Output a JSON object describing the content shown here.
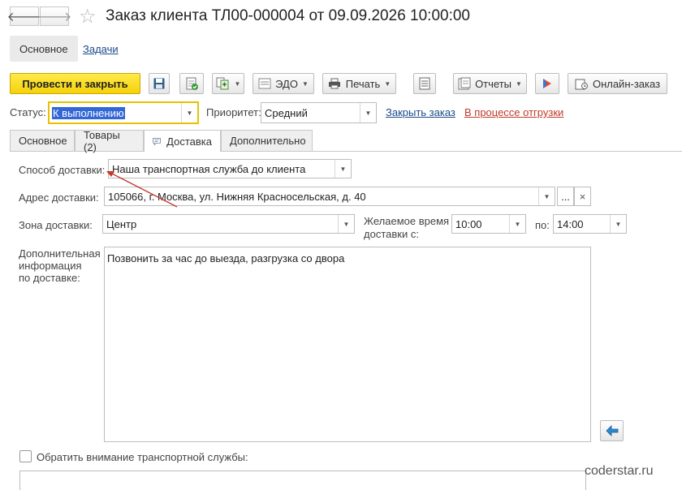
{
  "window": {
    "title": "Заказ клиента ТЛ00-000004 от 09.09.2026 10:00:00",
    "back_glyph": "🡐",
    "forward_glyph": "🡒",
    "star_glyph": "☆"
  },
  "sections": {
    "main": "Основное",
    "tasks": "Задачи"
  },
  "toolbar": {
    "post_close": "Провести и закрыть",
    "edo": "ЭДО",
    "print": "Печать",
    "reports": "Отчеты",
    "online_order": "Онлайн-заказ"
  },
  "status_row": {
    "status_label": "Статус:",
    "status_value": "К выполнению",
    "priority_label": "Приоритет:",
    "priority_value": "Средний",
    "close_order_link": "Закрыть заказ",
    "shipping_link": "В процессе отгрузки"
  },
  "tabs": [
    "Основное",
    "Товары (2)",
    "Доставка",
    "Дополнительно"
  ],
  "delivery": {
    "method_label": "Способ доставки:",
    "method_value": "Наша транспортная служба до клиента",
    "address_label": "Адрес доставки:",
    "address_value": "105066, г. Москва, ул. Нижняя Красносельская, д. 40",
    "address_more": "...",
    "address_clear": "×",
    "zone_label": "Зона доставки:",
    "zone_value": "Центр",
    "time_label_1": "Желаемое время",
    "time_label_2": "доставки с:",
    "time_from": "10:00",
    "to_label": "по:",
    "time_to": "14:00",
    "info_label_1": "Дополнительная",
    "info_label_2": "информация",
    "info_label_3": "по доставке:",
    "info_value": "Позвонить за час до выезда, разгрузка со двора",
    "attention_label": "Обратить внимание транспортной службы:"
  },
  "watermark": "coderstar.ru",
  "colors": {
    "primary_button": "#f5d20a",
    "link": "#1a4a8a",
    "shipping_link": "#c0392b",
    "focus_border": "#e6c200",
    "arrow": "#c0392b"
  }
}
